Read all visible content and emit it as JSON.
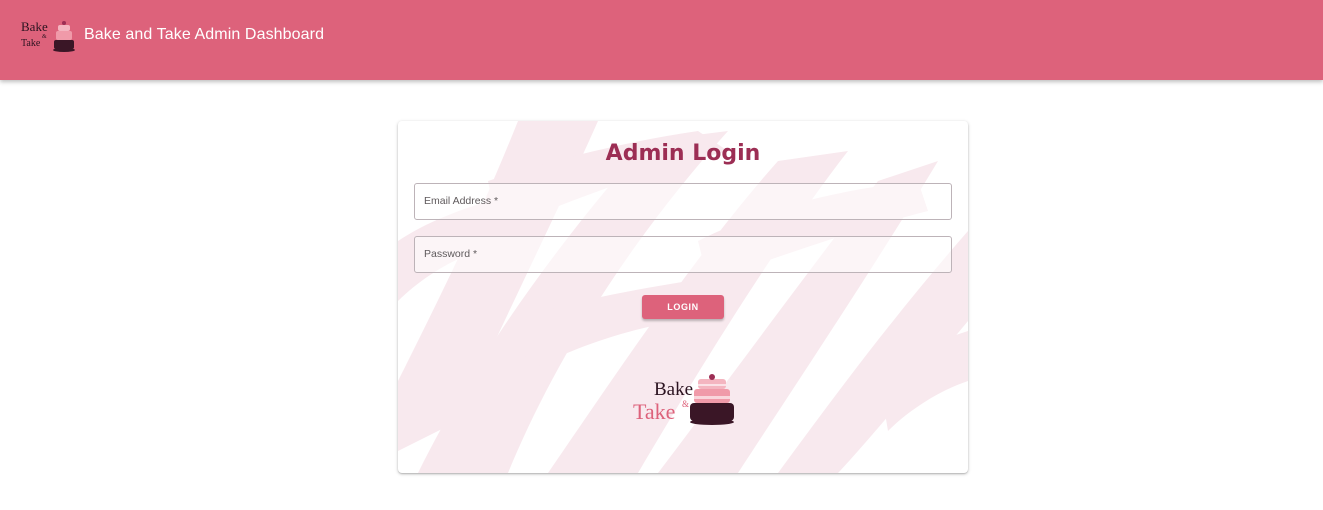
{
  "header": {
    "title": "Bake and Take Admin Dashboard",
    "logo_icon": "bake-and-take-logo",
    "logo_text_top": "Bake",
    "logo_text_mid": "&",
    "logo_text_bottom": "Take"
  },
  "login_card": {
    "title": "Admin Login",
    "email_label": "Email Address *",
    "email_value": "",
    "password_label": "Password *",
    "password_value": "",
    "login_button": "LOGIN"
  },
  "colors": {
    "primary": "#dd627b",
    "title": "#9c2e54",
    "brush": "#f8e9ee"
  }
}
